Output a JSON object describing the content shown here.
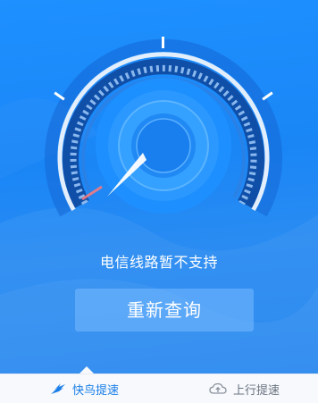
{
  "status": {
    "message": "电信线路暂不支持"
  },
  "actions": {
    "requery_label": "重新查询"
  },
  "tabs": [
    {
      "label": "快鸟提速",
      "icon": "bird-icon",
      "active": true
    },
    {
      "label": "上行提速",
      "icon": "cloud-upload-icon",
      "active": false
    }
  ],
  "gauge": {
    "needle_level": 0,
    "ring_color": "#d6e7fb",
    "accent_color": "#ff7a7a"
  },
  "colors": {
    "background": "#1e8cfa",
    "active_tab": "#1a7ee8",
    "inactive_tab": "#6a7380"
  }
}
